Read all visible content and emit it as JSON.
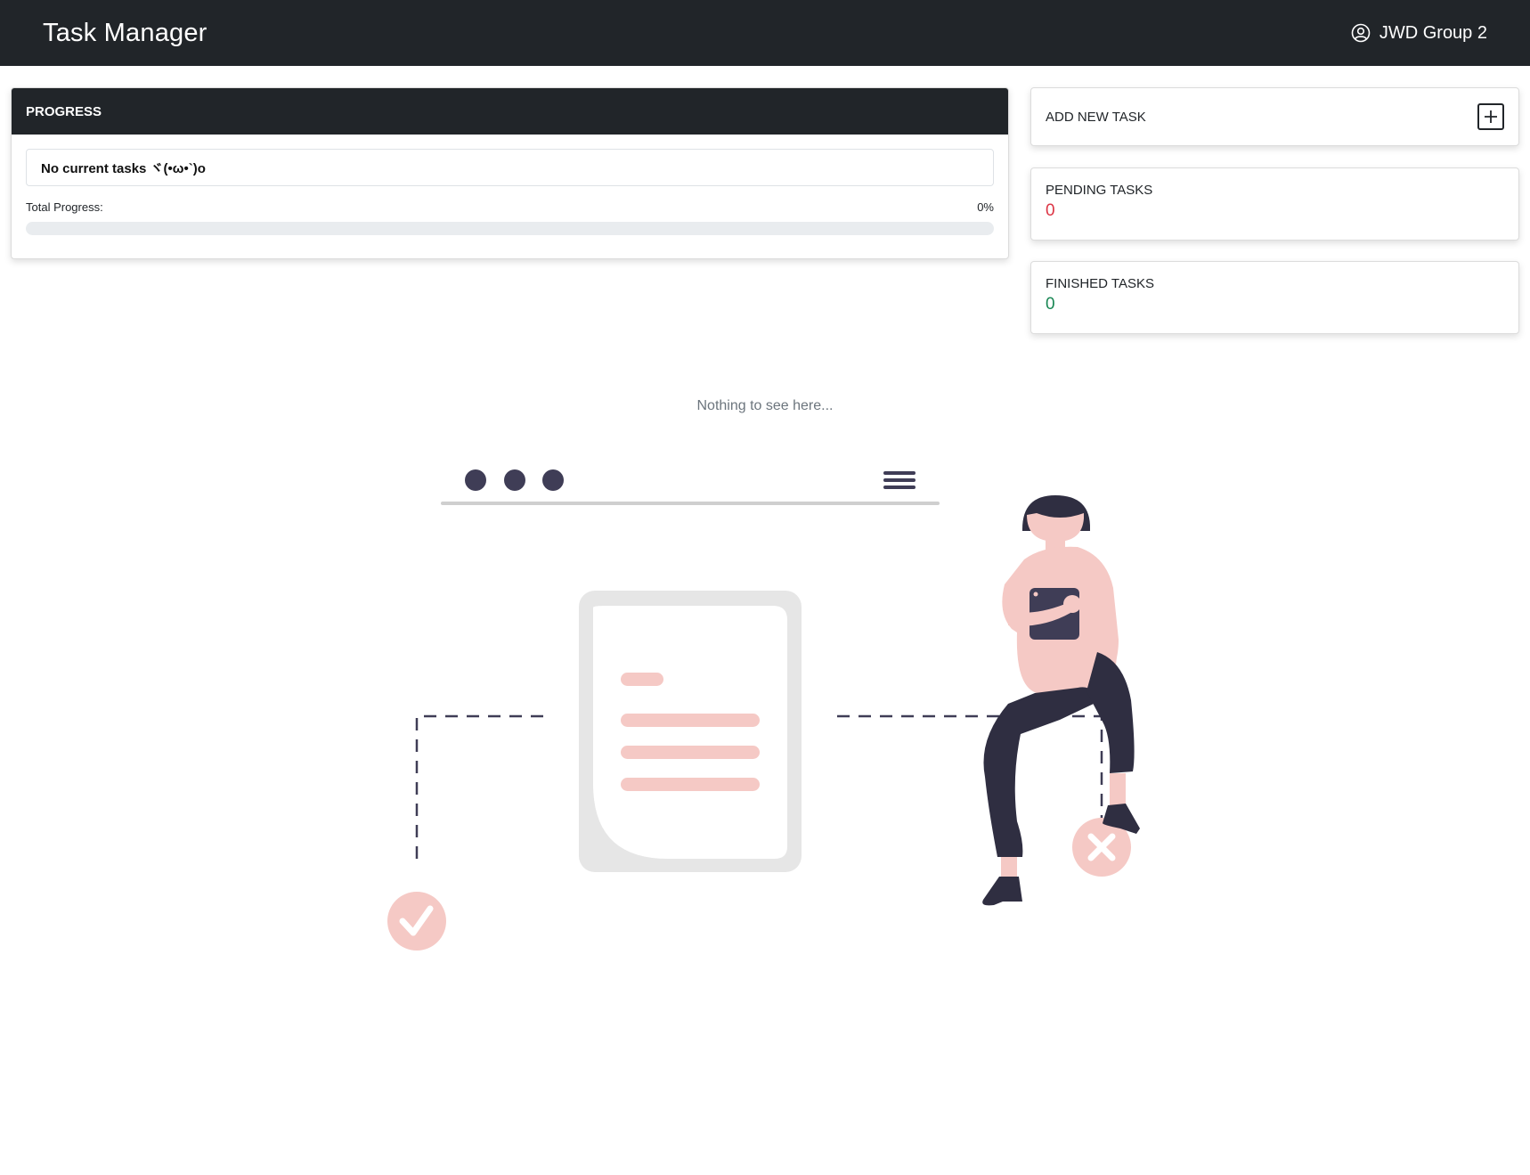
{
  "app": {
    "title": "Task Manager"
  },
  "user": {
    "name": "JWD Group 2",
    "icon": "user-circle-icon"
  },
  "progress": {
    "header": "PROGRESS",
    "empty_message": "No current tasks ヾ(•ω•`)o",
    "total_label": "Total Progress:",
    "percent_text": "0%",
    "percent_value": 0
  },
  "sidebar": {
    "add_label": "ADD NEW TASK",
    "add_icon": "plus-square-icon",
    "pending_label": "PENDING TASKS",
    "pending_count": "0",
    "finished_label": "FINISHED TASKS",
    "finished_count": "0"
  },
  "empty_state": {
    "text": "Nothing to see here..."
  },
  "colors": {
    "navbar": "#212529",
    "pending": "#dc3545",
    "finished": "#198754",
    "accent_pink": "#f5c9c5",
    "dark_figure": "#2f2e41"
  }
}
